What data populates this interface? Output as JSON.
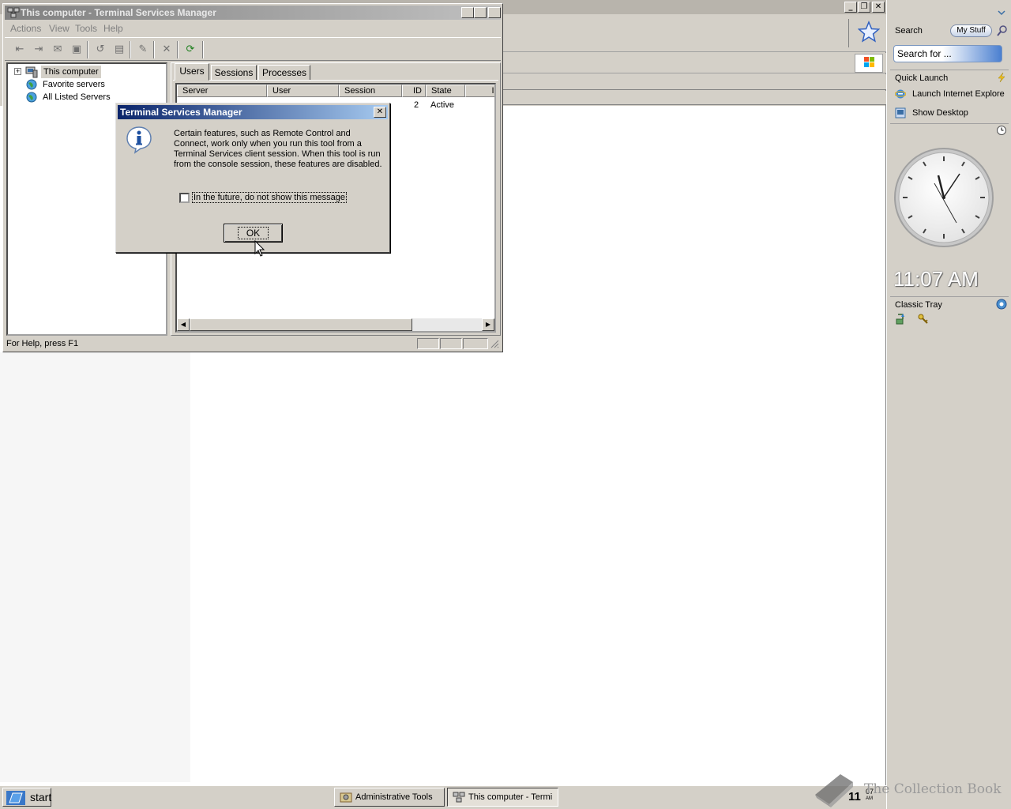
{
  "main_window": {
    "title": "This computer - Terminal Services Manager",
    "menu": [
      "Actions",
      "View",
      "Tools",
      "Help"
    ],
    "tree": {
      "items": [
        "This computer",
        "Favorite servers",
        "All Listed Servers"
      ]
    },
    "tabs": [
      "Users",
      "Sessions",
      "Processes"
    ],
    "table": {
      "columns": [
        "Server",
        "User",
        "Session",
        "ID",
        "State",
        "Ic"
      ],
      "rows": [
        {
          "server": "",
          "user": "",
          "session": "",
          "id": "2",
          "state": "Active"
        }
      ]
    },
    "status_text": "For Help, press F1"
  },
  "dialog": {
    "title": "Terminal Services Manager",
    "message": "Certain features, such as Remote Control and Connect, work only when you run this tool from a Terminal Services client session.  When this tool is run from the console session, these features are disabled.",
    "checkbox_label": "In the future, do not show this message",
    "checkbox_checked": false,
    "ok_label": "OK"
  },
  "sidebar": {
    "search_label": "Search",
    "my_stuff_label": "My Stuff",
    "search_placeholder": "Search for ...",
    "quick_launch_title": "Quick Launch",
    "quick_launch_items": [
      "Launch Internet Explore",
      "Show Desktop"
    ],
    "clock_time": "11:07 AM",
    "classic_tray_title": "Classic Tray"
  },
  "taskbar": {
    "start_label": "start",
    "tasks": [
      {
        "label": "Administrative Tools",
        "pressed": false
      },
      {
        "label": "This computer - Termi",
        "pressed": true
      }
    ],
    "tray_hour": "11",
    "tray_minute": "07",
    "tray_ampm": "AM"
  },
  "watermark": "The Collection Book",
  "colors": {
    "dialog_title_start": "#0a246a",
    "dialog_title_end": "#a6caf0",
    "window_face": "#d4d0c8"
  }
}
